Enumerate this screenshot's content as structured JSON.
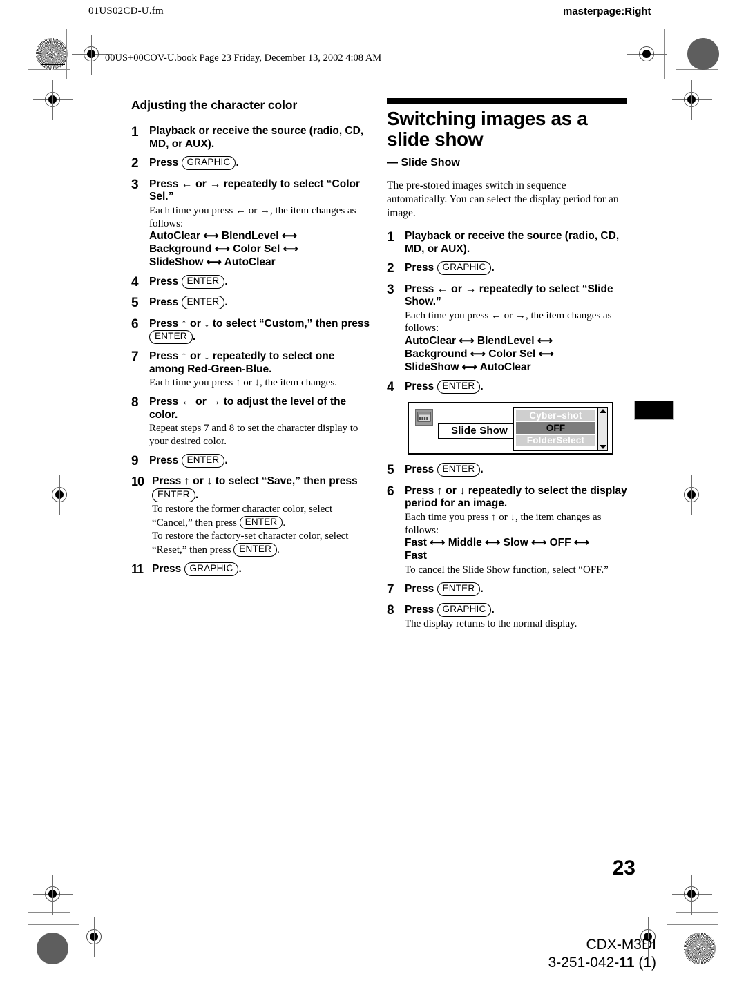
{
  "header": {
    "filename": "01US02CD-U.fm",
    "masterpage": "masterpage:Right",
    "bookline": "00US+00COV-U.book  Page 23  Friday, December 13, 2002  4:08 AM"
  },
  "left_column": {
    "section_title": "Adjusting the character color",
    "steps": [
      {
        "num": "1",
        "lead": "Playback or receive the source (radio, CD, MD, or AUX)."
      },
      {
        "num": "2",
        "lead_pre": "Press ",
        "key": "GRAPHIC",
        "lead_post": "."
      },
      {
        "num": "3",
        "lead_pre": "Press ",
        "lead_arrows": "← or →",
        "lead_post": " repeatedly to select “Color Sel.”",
        "note": "Each time you press ← or →, the item changes as follows:",
        "chain": [
          "AutoClear ⟷ BlendLevel ⟷",
          "Background ⟷ Color Sel ⟷",
          "SlideShow ⟷ AutoClear"
        ]
      },
      {
        "num": "4",
        "lead_pre": "Press ",
        "key": "ENTER",
        "lead_post": "."
      },
      {
        "num": "5",
        "lead_pre": "Press ",
        "key": "ENTER",
        "lead_post": "."
      },
      {
        "num": "6",
        "lead_pre": "Press ",
        "lead_arrows": "↑ or ↓",
        "lead_post": " to select “Custom,” then press ",
        "key": "ENTER",
        "lead_tail": "."
      },
      {
        "num": "7",
        "lead_pre": "Press ",
        "lead_arrows": "↑ or ↓",
        "lead_post": " repeatedly to select one among Red-Green-Blue.",
        "note": "Each time you press ↑ or ↓, the item changes."
      },
      {
        "num": "8",
        "lead_pre": "Press ",
        "lead_arrows": "← or →",
        "lead_post": " to adjust the level of the color.",
        "note": "Repeat steps 7 and 8 to set the character display to your desired color."
      },
      {
        "num": "9",
        "lead_pre": "Press ",
        "key": "ENTER",
        "lead_post": "."
      },
      {
        "num": "10",
        "lead_pre": "Press ",
        "lead_arrows": "↑ or ↓",
        "lead_post": " to select “Save,” then press ",
        "key": "ENTER",
        "lead_tail": ".",
        "note_a_1": "To restore the former character color, select “Cancel,” then press ",
        "note_a_key": "ENTER",
        "note_a_2": ".",
        "note_b_1": "To restore the factory-set character color, select “Reset,” then press ",
        "note_b_key": "ENTER",
        "note_b_2": "."
      },
      {
        "num": "11",
        "lead_pre": "Press ",
        "key": "GRAPHIC",
        "lead_post": "."
      }
    ]
  },
  "right_column": {
    "chapter_title": "Switching images as a slide show",
    "chapter_subtitle": "— Slide Show",
    "intro": "The pre-stored images switch in sequence automatically. You can select the display period for an image.",
    "steps": [
      {
        "num": "1",
        "lead": "Playback or receive the source (radio, CD, MD, or AUX)."
      },
      {
        "num": "2",
        "lead_pre": "Press ",
        "key": "GRAPHIC",
        "lead_post": "."
      },
      {
        "num": "3",
        "lead_pre": "Press ",
        "lead_arrows": "← or →",
        "lead_post": " repeatedly to select “Slide Show.”",
        "note": "Each time you press ← or →, the item changes as follows:",
        "chain": [
          "AutoClear ⟷ BlendLevel ⟷",
          "Background ⟷ Color Sel ⟷",
          "SlideShow ⟷ AutoClear"
        ]
      },
      {
        "num": "4",
        "lead_pre": "Press ",
        "key": "ENTER",
        "lead_post": "."
      },
      {
        "num": "5",
        "lead_pre": "Press ",
        "key": "ENTER",
        "lead_post": "."
      },
      {
        "num": "6",
        "lead_pre": "Press ",
        "lead_arrows": "↑ or ↓",
        "lead_post": " repeatedly to select the display period for an image.",
        "note": "Each time you press ↑ or ↓, the item changes as follows:",
        "chain": [
          "Fast ⟷ Middle ⟷ Slow ⟷ OFF ⟷",
          "Fast"
        ],
        "note2": "To cancel the Slide Show function, select “OFF.”"
      },
      {
        "num": "7",
        "lead_pre": "Press ",
        "key": "ENTER",
        "lead_post": "."
      },
      {
        "num": "8",
        "lead_pre": "Press ",
        "key": "GRAPHIC",
        "lead_post": ".",
        "note": "The display returns to the normal display."
      }
    ],
    "figure": {
      "icon_name": "slide-show-display-icon",
      "label": "Slide Show",
      "list": [
        {
          "text": "Cyber–shot",
          "state": "dim"
        },
        {
          "text": "OFF",
          "state": "selected"
        },
        {
          "text": "FolderSelect",
          "state": "dim"
        }
      ],
      "colors": {
        "dim_bg": "#cfcfcf",
        "dim_fg": "#ffffff",
        "sel_bg": "#7d7d7d",
        "sel_fg": "#000000"
      }
    }
  },
  "footer": {
    "page_number": "23",
    "model": "CDX-M3DI",
    "code_prefix": "3-251-042-",
    "code_bold": "11",
    "code_suffix": " (1)"
  }
}
